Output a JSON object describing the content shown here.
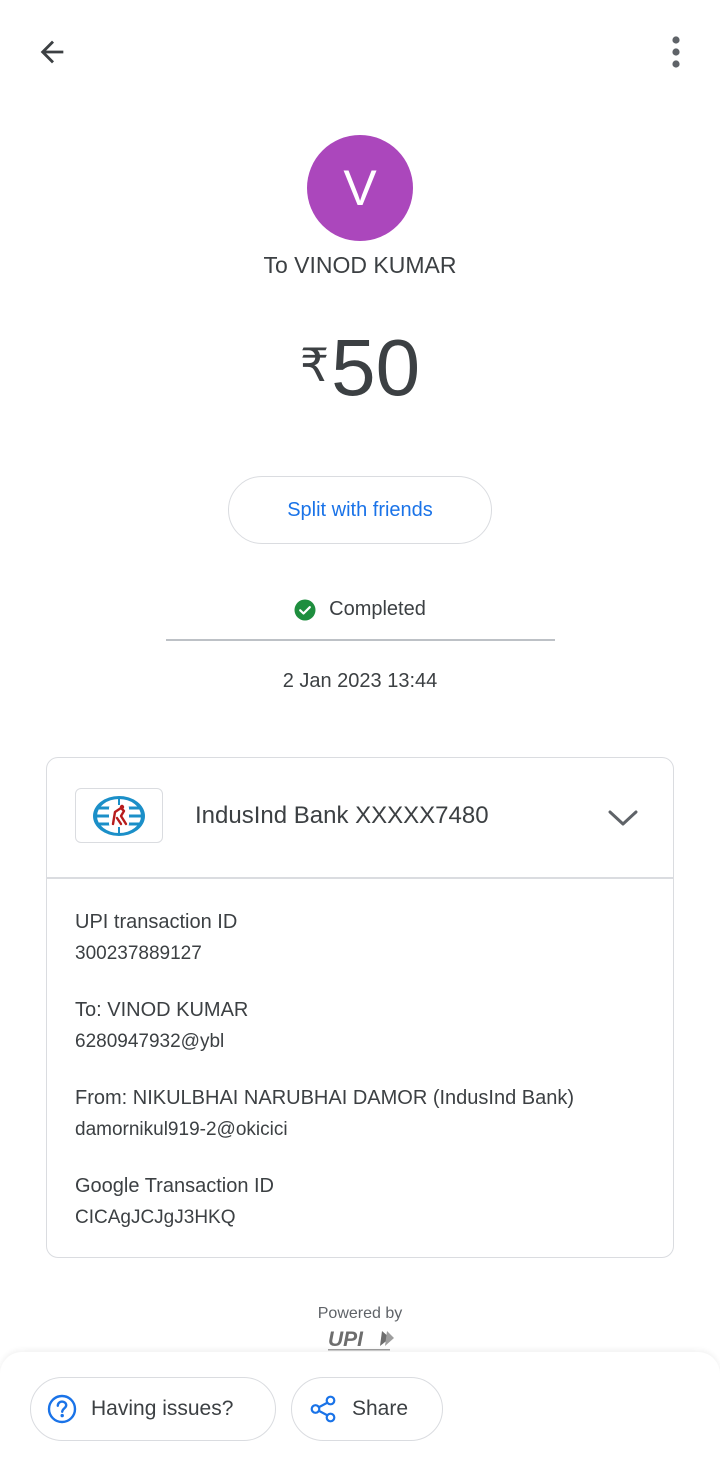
{
  "header": {
    "back_icon": "arrow-back-icon",
    "more_icon": "more-vert-icon"
  },
  "payee": {
    "avatar_initial": "V",
    "avatar_color": "#ab47bc",
    "title": "To VINOD KUMAR"
  },
  "amount": {
    "currency_symbol": "₹",
    "value": "50"
  },
  "split_button": {
    "label": "Split with friends",
    "color": "#1a73e8"
  },
  "status": {
    "icon": "check-circle-icon",
    "icon_color": "#1e8e3e",
    "label": "Completed",
    "datetime": "2 Jan 2023 13:44"
  },
  "bank": {
    "logo_icon": "indusind-bank-logo",
    "name": "IndusInd Bank XXXXX7480",
    "expand_icon": "chevron-down-icon"
  },
  "details": [
    {
      "label": "UPI transaction ID",
      "value": "300237889127"
    },
    {
      "label": "To: VINOD KUMAR",
      "value": "6280947932@ybl"
    },
    {
      "label": "From: NIKULBHAI NARUBHAI DAMOR (IndusInd Bank)",
      "value": "damornikul919-2@okicici"
    },
    {
      "label": "Google Transaction ID",
      "value": "CICAgJCJgJ3HKQ"
    }
  ],
  "footer": {
    "powered_by": "Powered by",
    "upi_logo_text": "UPI",
    "issues_button": {
      "label": "Having issues?",
      "icon": "help-circle-icon"
    },
    "share_button": {
      "label": "Share",
      "icon": "share-icon"
    },
    "accent_color": "#1a73e8"
  }
}
